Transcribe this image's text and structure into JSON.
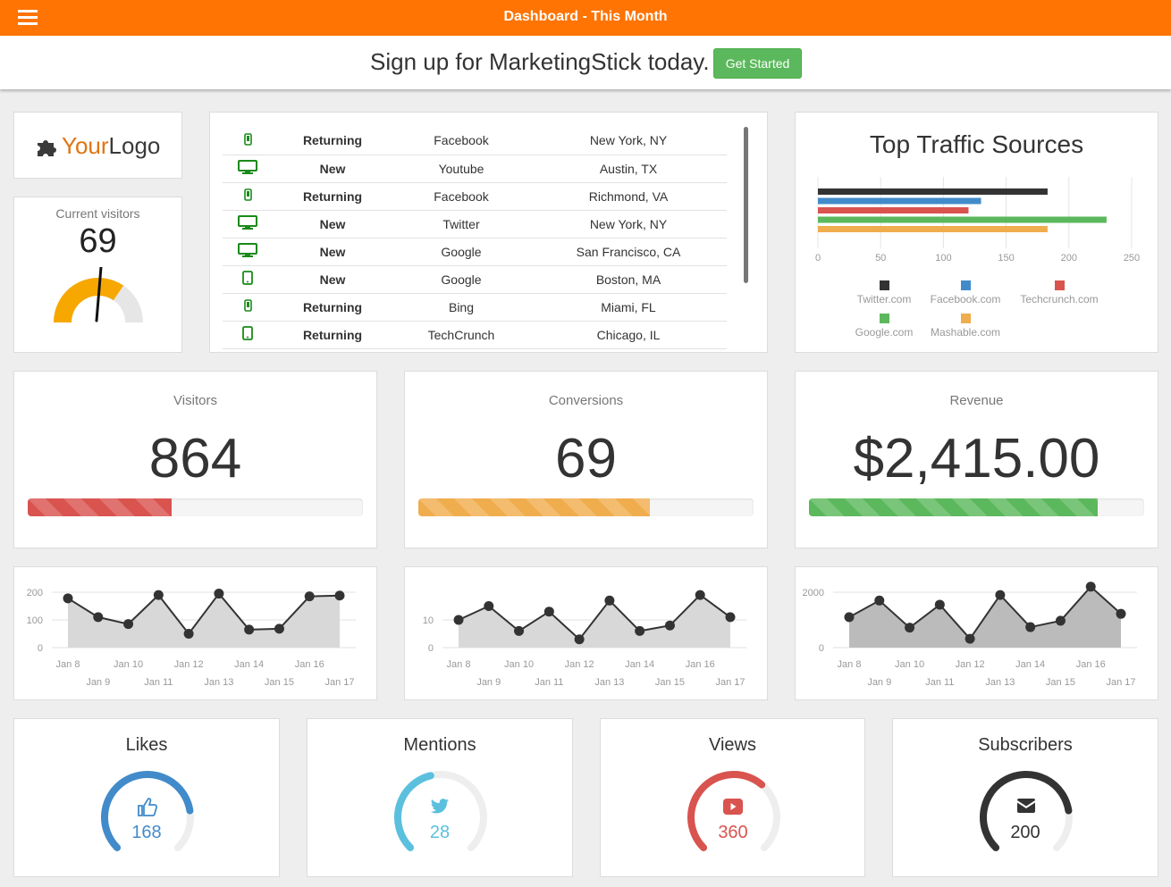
{
  "header": {
    "title": "Dashboard - This Month"
  },
  "signup": {
    "text": "Sign up for MarketingStick today.",
    "button": "Get Started"
  },
  "logo": {
    "your": "Your",
    "logo": "Logo"
  },
  "current_visitors": {
    "label": "Current visitors",
    "value": "69",
    "gauge_fraction": 0.69
  },
  "visits": [
    {
      "device": "mobile",
      "type": "Returning",
      "source": "Facebook",
      "location": "New York, NY"
    },
    {
      "device": "desktop",
      "type": "New",
      "source": "Youtube",
      "location": "Austin, TX"
    },
    {
      "device": "mobile",
      "type": "Returning",
      "source": "Facebook",
      "location": "Richmond, VA"
    },
    {
      "device": "desktop",
      "type": "New",
      "source": "Twitter",
      "location": "New York, NY"
    },
    {
      "device": "desktop",
      "type": "New",
      "source": "Google",
      "location": "San Francisco, CA"
    },
    {
      "device": "tablet",
      "type": "New",
      "source": "Google",
      "location": "Boston, MA"
    },
    {
      "device": "mobile",
      "type": "Returning",
      "source": "Bing",
      "location": "Miami, FL"
    },
    {
      "device": "tablet",
      "type": "Returning",
      "source": "TechCrunch",
      "location": "Chicago, IL"
    }
  ],
  "traffic": {
    "title": "Top Traffic Sources",
    "sources": [
      {
        "name": "Twitter.com",
        "color": "#333333"
      },
      {
        "name": "Facebook.com",
        "color": "#428bca"
      },
      {
        "name": "Techcrunch.com",
        "color": "#d9534f"
      },
      {
        "name": "Google.com",
        "color": "#5cb85c"
      },
      {
        "name": "Mashable.com",
        "color": "#f0ad4e"
      }
    ]
  },
  "stats": [
    {
      "label": "Visitors",
      "value": "864",
      "progress": 0.43,
      "color": "#d9534f"
    },
    {
      "label": "Conversions",
      "value": "69",
      "progress": 0.69,
      "color": "#f0ad4e"
    },
    {
      "label": "Revenue",
      "value": "$2,415.00",
      "progress": 0.86,
      "color": "#5cb85c"
    }
  ],
  "chart_data": [
    {
      "type": "bar",
      "title": "Top Traffic Sources",
      "categories": [
        "Twitter.com",
        "Facebook.com",
        "Techcrunch.com",
        "Google.com",
        "Mashable.com"
      ],
      "values": [
        183,
        130,
        120,
        230,
        183
      ],
      "xlim": [
        0,
        250
      ],
      "xticks": [
        "0",
        "50",
        "100",
        "150",
        "200",
        "250"
      ],
      "orientation": "horizontal",
      "legend": "bottom"
    },
    {
      "type": "area",
      "x": [
        "Jan 8",
        "Jan 9",
        "Jan 10",
        "Jan 11",
        "Jan 12",
        "Jan 13",
        "Jan 14",
        "Jan 15",
        "Jan 16",
        "Jan 17"
      ],
      "values": [
        178,
        110,
        85,
        190,
        50,
        195,
        65,
        68,
        185,
        188
      ],
      "ylim": [
        0,
        200
      ],
      "yticks": [
        "200",
        "100",
        "0"
      ],
      "color": "#d8d8d8"
    },
    {
      "type": "area",
      "x": [
        "Jan 8",
        "Jan 9",
        "Jan 10",
        "Jan 11",
        "Jan 12",
        "Jan 13",
        "Jan 14",
        "Jan 15",
        "Jan 16",
        "Jan 17"
      ],
      "values": [
        10,
        15,
        6,
        13,
        3,
        17,
        6,
        8,
        19,
        11
      ],
      "ylim": [
        0,
        20
      ],
      "yticks": [
        "10",
        "0"
      ],
      "color": "#d8d8d8"
    },
    {
      "type": "area",
      "x": [
        "Jan 8",
        "Jan 9",
        "Jan 10",
        "Jan 11",
        "Jan 12",
        "Jan 13",
        "Jan 14",
        "Jan 15",
        "Jan 16",
        "Jan 17"
      ],
      "values": [
        1100,
        1700,
        720,
        1550,
        320,
        1900,
        740,
        970,
        2200,
        1220
      ],
      "ylim": [
        0,
        2000
      ],
      "yticks": [
        "2000",
        "0"
      ],
      "color": "#bbbbbb"
    }
  ],
  "social": [
    {
      "label": "Likes",
      "value": "168",
      "icon": "thumbs-up-icon",
      "color": "#428bca",
      "fraction": 0.8
    },
    {
      "label": "Mentions",
      "value": "28",
      "icon": "twitter-icon",
      "color": "#5bc0de",
      "fraction": 0.45
    },
    {
      "label": "Views",
      "value": "360",
      "icon": "youtube-icon",
      "color": "#d9534f",
      "fraction": 0.65
    },
    {
      "label": "Subscribers",
      "value": "200",
      "icon": "envelope-icon",
      "color": "#333333",
      "fraction": 0.8
    }
  ]
}
